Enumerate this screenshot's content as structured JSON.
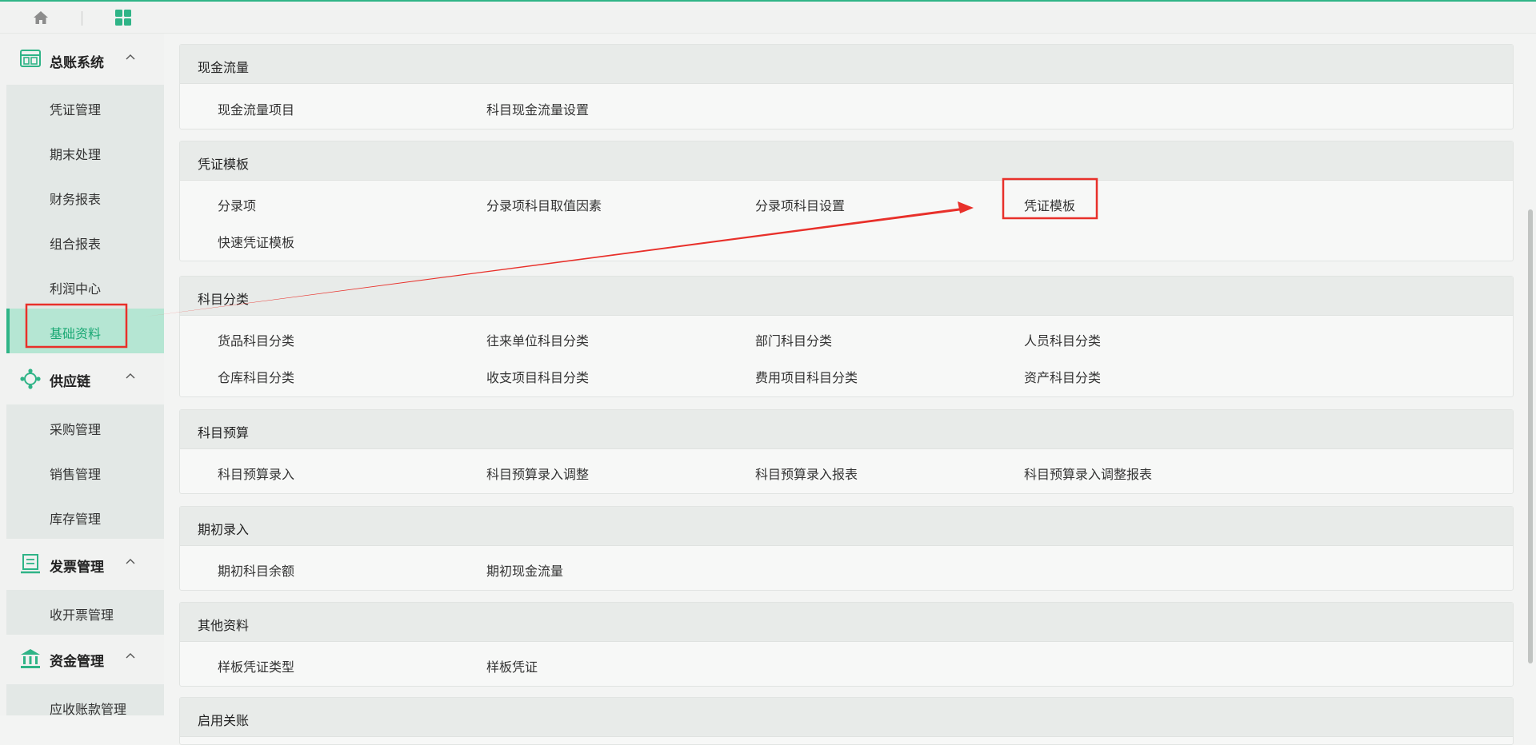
{
  "sidebar": {
    "groups": [
      {
        "label": "总账系统",
        "icon": "ledger-icon",
        "items": [
          "凭证管理",
          "期末处理",
          "财务报表",
          "组合报表",
          "利润中心",
          "基础资料"
        ]
      },
      {
        "label": "供应链",
        "icon": "supply-chain-icon",
        "items": [
          "采购管理",
          "销售管理",
          "库存管理"
        ]
      },
      {
        "label": "发票管理",
        "icon": "invoice-icon",
        "items": [
          "收开票管理"
        ]
      },
      {
        "label": "资金管理",
        "icon": "bank-icon",
        "items": [
          "应收账款管理"
        ]
      }
    ],
    "active_item": "基础资料"
  },
  "sections": [
    {
      "title": "现金流量",
      "links": [
        "现金流量项目",
        "科目现金流量设置"
      ]
    },
    {
      "title": "凭证模板",
      "links": [
        "分录项",
        "分录项科目取值因素",
        "分录项科目设置",
        "凭证模板",
        "快速凭证模板"
      ]
    },
    {
      "title": "科目分类",
      "links": [
        "货品科目分类",
        "往来单位科目分类",
        "部门科目分类",
        "人员科目分类",
        "仓库科目分类",
        "收支项目科目分类",
        "费用项目科目分类",
        "资产科目分类"
      ]
    },
    {
      "title": "科目预算",
      "links": [
        "科目预算录入",
        "科目预算录入调整",
        "科目预算录入报表",
        "科目预算录入调整报表"
      ]
    },
    {
      "title": "期初录入",
      "links": [
        "期初科目余额",
        "期初现金流量"
      ]
    },
    {
      "title": "其他资料",
      "links": [
        "样板凭证类型",
        "样板凭证"
      ]
    },
    {
      "title": "启用关账",
      "links": []
    }
  ],
  "annotation": {
    "color": "#e8302a",
    "highlighted": [
      "基础资料",
      "凭证模板"
    ]
  },
  "colors": {
    "accent": "#2fb487",
    "active_bg": "#b5e6d3"
  }
}
